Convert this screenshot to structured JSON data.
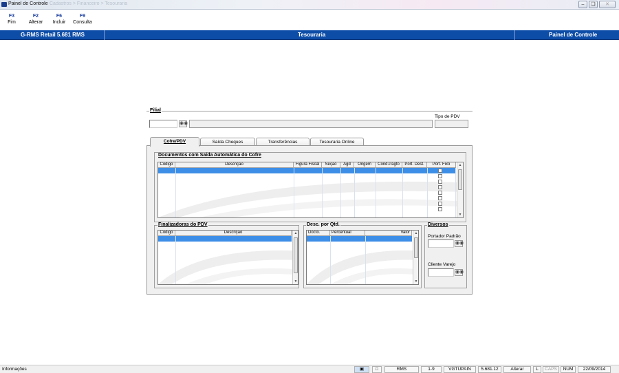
{
  "window": {
    "title": "Painel de Controle",
    "title_suffix": "Cadastros > Financeiro > Tesouraria"
  },
  "toolbar": [
    {
      "key": "F3",
      "label": "Fim"
    },
    {
      "key": "F2",
      "label": "Alterar"
    },
    {
      "key": "F6",
      "label": "Incluir"
    },
    {
      "key": "F9",
      "label": "Consulta"
    }
  ],
  "header": {
    "app": "G-RMS Retail 5.681 RMS",
    "module": "Tesouraria",
    "screen": "Painel de Controle"
  },
  "filial": {
    "label": "Filial",
    "value": "",
    "name": "",
    "tipo_pdv_label": "Tipo de PDV",
    "tipo_pdv_value": ""
  },
  "tabs": [
    "Cofre/PDV",
    "Saída Cheques",
    "Transferências",
    "Tesouraria Online"
  ],
  "documentos": {
    "title": "Documentos com Saída Automática do Cofre",
    "columns": [
      "Código",
      "Descrição",
      "Figura Fiscal",
      "Seção",
      "Agd",
      "Origem",
      "Cond.Pagto",
      "Port. Dest.",
      "Port. Fixo"
    ]
  },
  "finalizadoras": {
    "title": "Finalizadoras do PDV",
    "columns": [
      "Código",
      "Descrição"
    ]
  },
  "desc_qtd": {
    "title": "Desc. por Qtd.",
    "columns": [
      "Docto.",
      "Percentual",
      "Valor"
    ]
  },
  "diversos": {
    "title": "Diversos",
    "portador_label": "Portador Padrão",
    "portador_value": "",
    "cliente_label": "Cliente Varejo",
    "cliente_value": ""
  },
  "status": {
    "left": "Informações",
    "items": [
      "RMS",
      "1-9",
      "VGTUPAIN",
      "5.681.12",
      "Alterar",
      "L",
      "CAPS",
      "NUM",
      "22/09/2014"
    ]
  },
  "colors": {
    "accent": "#0d4da8",
    "selection": "#3d8ee6"
  },
  "icons": {
    "search": "binoculars-icon"
  }
}
